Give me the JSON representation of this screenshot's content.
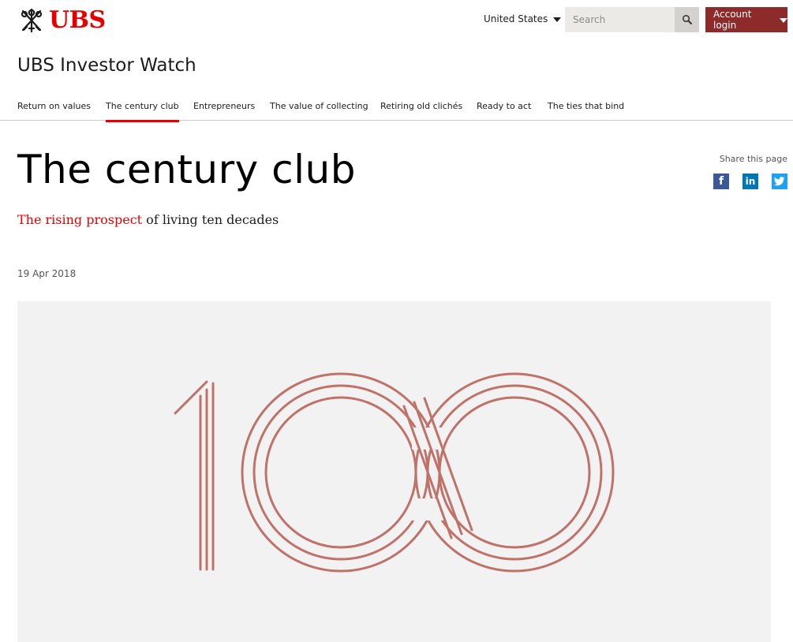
{
  "header": {
    "logo_text": "UBS",
    "region": "United States",
    "search_placeholder": "Search",
    "account_label": "Account login",
    "site_title": "UBS Investor Watch"
  },
  "nav": {
    "items": [
      {
        "label": "Return on values"
      },
      {
        "label": "The century club",
        "active": true
      },
      {
        "label": "Entrepreneurs"
      },
      {
        "label": "The value of collecting"
      },
      {
        "label": "Retiring old clichés"
      },
      {
        "label": "Ready to act"
      },
      {
        "label": "The ties that bind"
      }
    ]
  },
  "article": {
    "title": "The century club",
    "subtitle_accent": "The rising prospect",
    "subtitle_rest": " of living ten decades",
    "date": "19 Apr 2018"
  },
  "share": {
    "label": "Share this page",
    "icons": [
      "facebook-icon",
      "linkedin-icon",
      "twitter-icon"
    ]
  },
  "hero": {
    "image": "stylized-100-line-art",
    "line_color": "#c07268"
  },
  "colors": {
    "brand_red": "#e60000",
    "account_button": "#8d2a2a",
    "hero_background": "#f2f2f2"
  }
}
